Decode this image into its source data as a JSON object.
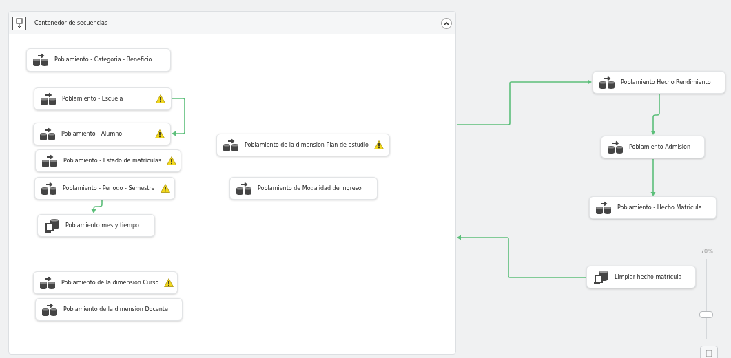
{
  "container": {
    "title": "Contenedor de secuencias",
    "expanded": true
  },
  "nodes": [
    {
      "label": "Poblamiento - Categoria - Beneficio",
      "kind": "dataflow",
      "warning": false
    },
    {
      "label": "Poblamiento - Escuela",
      "kind": "dataflow",
      "warning": true
    },
    {
      "label": "Poblamiento - Alumno",
      "kind": "dataflow",
      "warning": true
    },
    {
      "label": "Poblamiento - Estado de matrículas",
      "kind": "dataflow",
      "warning": true
    },
    {
      "label": "Poblamiento - Periodo - Semestre",
      "kind": "dataflow",
      "warning": true
    },
    {
      "label": "Poblamiento mes y tiempo",
      "kind": "sql",
      "warning": false
    },
    {
      "label": "Poblamiento de la dimension Curso",
      "kind": "dataflow",
      "warning": true
    },
    {
      "label": "Poblamiento de la dimension Docente",
      "kind": "dataflow",
      "warning": false
    },
    {
      "label": "Poblamiento de la dimension Plan de estudio",
      "kind": "dataflow",
      "warning": true
    },
    {
      "label": "Poblamiento de Modalidad de Ingreso",
      "kind": "dataflow",
      "warning": false
    },
    {
      "label": "Poblamiento Hecho Rendimiento",
      "kind": "dataflow",
      "warning": false
    },
    {
      "label": "Poblamiento Admision",
      "kind": "dataflow",
      "warning": false
    },
    {
      "label": "Poblamiento - Hecho Matricula",
      "kind": "dataflow",
      "warning": false
    },
    {
      "label": "Limpiar hecho matrícula",
      "kind": "sql",
      "warning": false
    }
  ],
  "zoom": {
    "label": "70%",
    "level": 0.3
  }
}
